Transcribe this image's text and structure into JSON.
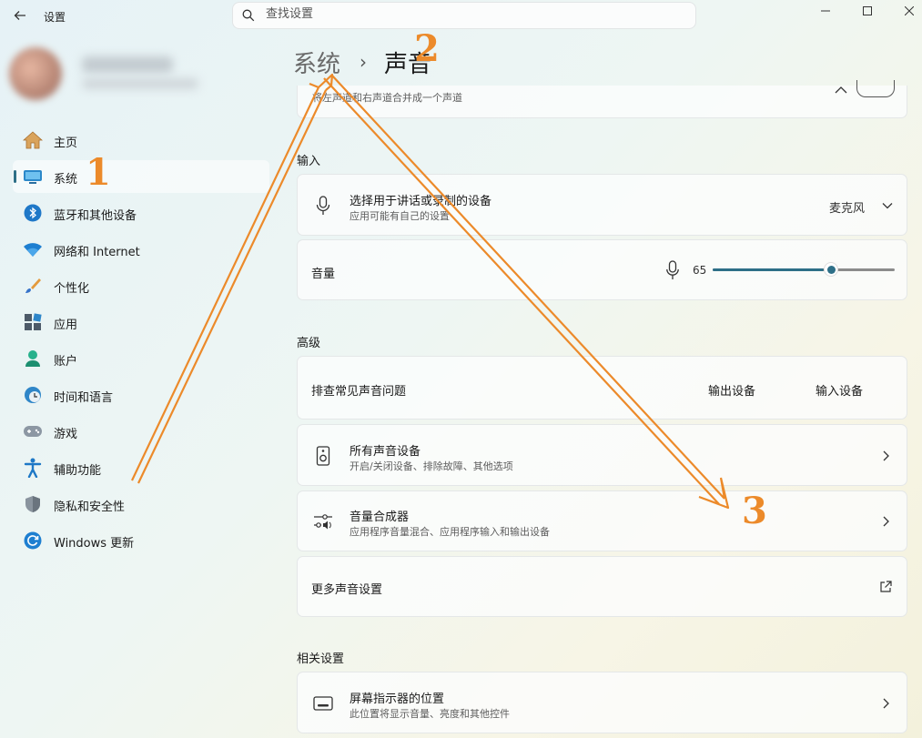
{
  "window": {
    "title": "设置",
    "back_icon": "back-arrow-icon"
  },
  "search": {
    "placeholder": "查找设置"
  },
  "breadcrumb": {
    "parent": "系统",
    "separator": "›",
    "current": "声音"
  },
  "nav": [
    {
      "label": "主页",
      "icon": "home-icon"
    },
    {
      "label": "系统",
      "icon": "system-icon",
      "active": true
    },
    {
      "label": "蓝牙和其他设备",
      "icon": "bluetooth-icon"
    },
    {
      "label": "网络和 Internet",
      "icon": "wifi-icon"
    },
    {
      "label": "个性化",
      "icon": "brush-icon"
    },
    {
      "label": "应用",
      "icon": "apps-icon"
    },
    {
      "label": "账户",
      "icon": "account-icon"
    },
    {
      "label": "时间和语言",
      "icon": "clock-globe-icon"
    },
    {
      "label": "游戏",
      "icon": "gamepad-icon"
    },
    {
      "label": "辅助功能",
      "icon": "accessibility-icon"
    },
    {
      "label": "隐私和安全性",
      "icon": "shield-icon"
    },
    {
      "label": "Windows 更新",
      "icon": "update-icon"
    }
  ],
  "top_card": {
    "subtitle": "将左声道和右声道合并成一个声道"
  },
  "input": {
    "section": "输入",
    "device": {
      "title": "选择用于讲话或录制的设备",
      "subtitle": "应用可能有自己的设置",
      "value": "麦克风"
    },
    "volume": {
      "label": "音量",
      "value": "65",
      "level": 0.65
    }
  },
  "advanced": {
    "section": "高级",
    "troubleshoot": {
      "label": "排查常见声音问题",
      "btn_output": "输出设备",
      "btn_input": "输入设备"
    },
    "all_devices": {
      "title": "所有声音设备",
      "subtitle": "开启/关闭设备、排除故障、其他选项"
    },
    "mixer": {
      "title": "音量合成器",
      "subtitle": "应用程序音量混合、应用程序输入和输出设备"
    },
    "more": {
      "label": "更多声音设置"
    }
  },
  "related": {
    "section": "相关设置",
    "indicator": {
      "title": "屏幕指示器的位置",
      "subtitle": "此位置将显示音量、亮度和其他控件"
    }
  },
  "annotations": [
    "1",
    "2",
    "3"
  ],
  "colors": {
    "accent": "#2d6f87",
    "annotation": "#ec8a2a"
  }
}
